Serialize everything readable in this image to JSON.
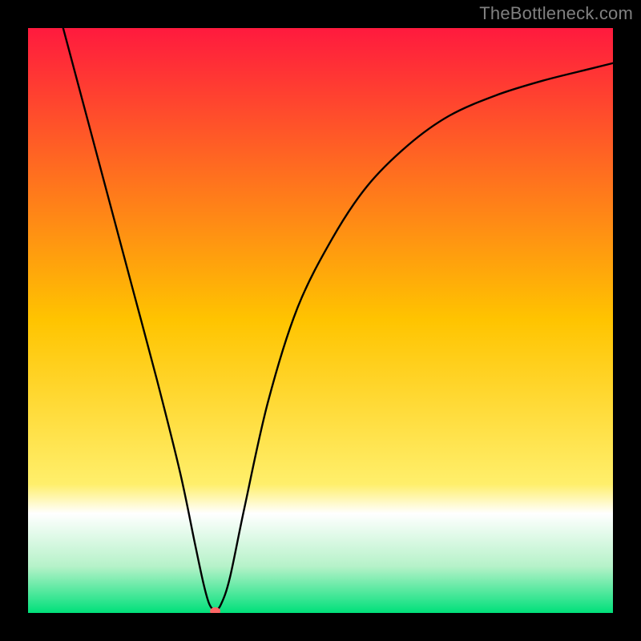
{
  "watermark": "TheBottleneck.com",
  "chart_data": {
    "type": "line",
    "title": "",
    "xlabel": "",
    "ylabel": "",
    "xlim": [
      0,
      100
    ],
    "ylim": [
      0,
      100
    ],
    "grid": false,
    "legend": false,
    "gradient_stops": [
      {
        "pos": 0.0,
        "color": "#ff1a3e"
      },
      {
        "pos": 0.5,
        "color": "#ffc400"
      },
      {
        "pos": 0.78,
        "color": "#ffef6b"
      },
      {
        "pos": 0.83,
        "color": "#ffffff"
      },
      {
        "pos": 0.92,
        "color": "#b6f2c9"
      },
      {
        "pos": 1.0,
        "color": "#00e07a"
      }
    ],
    "series": [
      {
        "name": "bottleneck-curve",
        "x": [
          6,
          10,
          14,
          18,
          22,
          26,
          28.5,
          30,
          31,
          32,
          33,
          34.5,
          37,
          41,
          46,
          52,
          58,
          65,
          72,
          80,
          88,
          96,
          100
        ],
        "y": [
          100,
          85,
          70,
          55,
          40,
          24,
          12,
          5,
          1.5,
          0.5,
          1.5,
          6,
          18,
          36,
          52,
          64,
          73,
          80,
          85,
          88.5,
          91,
          93,
          94
        ],
        "color": "#000000"
      }
    ],
    "marker": {
      "x": 32,
      "y": 0.3,
      "color": "#ff6666",
      "radius_px": 6.5
    }
  }
}
